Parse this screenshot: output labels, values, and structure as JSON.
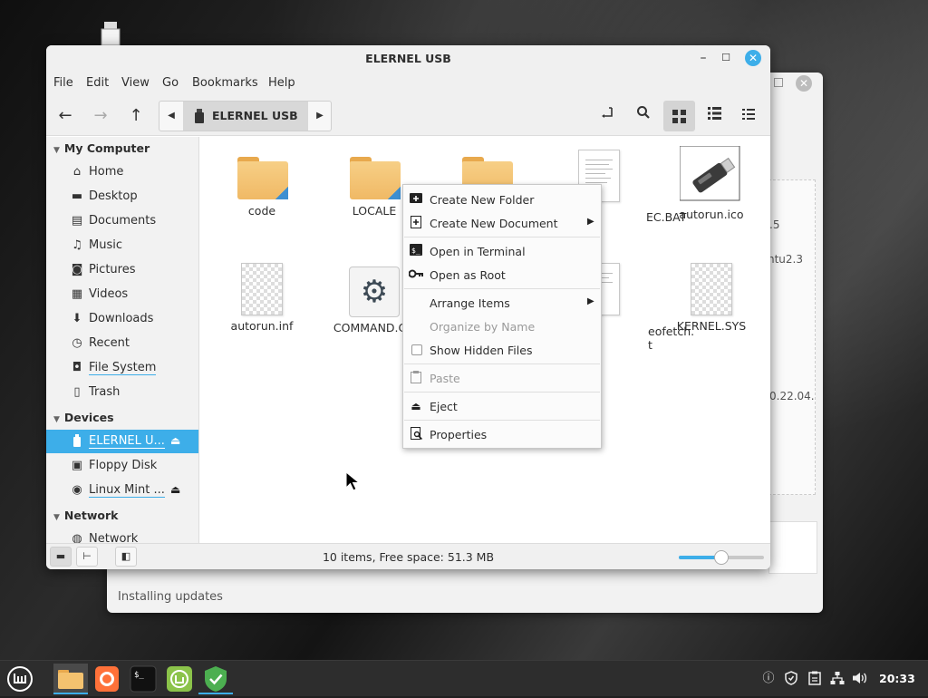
{
  "window": {
    "title": "ELERNEL USB"
  },
  "menubar": [
    "File",
    "Edit",
    "View",
    "Go",
    "Bookmarks",
    "Help"
  ],
  "pathbar": {
    "current": "ELERNEL USB"
  },
  "sidebar": {
    "sections": [
      {
        "title": "My Computer",
        "items": [
          {
            "label": "Home",
            "icon": "home-icon"
          },
          {
            "label": "Desktop",
            "icon": "desktop-icon"
          },
          {
            "label": "Documents",
            "icon": "documents-icon"
          },
          {
            "label": "Music",
            "icon": "music-icon"
          },
          {
            "label": "Pictures",
            "icon": "pictures-icon"
          },
          {
            "label": "Videos",
            "icon": "videos-icon"
          },
          {
            "label": "Downloads",
            "icon": "downloads-icon"
          },
          {
            "label": "Recent",
            "icon": "recent-icon"
          },
          {
            "label": "File System",
            "icon": "filesystem-icon"
          },
          {
            "label": "Trash",
            "icon": "trash-icon"
          }
        ]
      },
      {
        "title": "Devices",
        "items": [
          {
            "label": "ELERNEL U...",
            "icon": "usb-drive-icon",
            "active": true,
            "eject": true
          },
          {
            "label": "Floppy Disk",
            "icon": "floppy-icon"
          },
          {
            "label": "Linux Mint ...",
            "icon": "disc-icon",
            "eject": true
          }
        ]
      },
      {
        "title": "Network",
        "items": [
          {
            "label": "Network",
            "icon": "network-icon"
          }
        ]
      }
    ]
  },
  "files": [
    {
      "name": "code",
      "type": "folder"
    },
    {
      "name": "LOCALE",
      "type": "folder"
    },
    {
      "name": "",
      "type": "folder"
    },
    {
      "name": "EC.BAT",
      "type": "text"
    },
    {
      "name": "autorun.ico",
      "type": "usb-image"
    },
    {
      "name": "autorun.inf",
      "type": "blank"
    },
    {
      "name": "COMMAND.CO",
      "type": "executable"
    },
    {
      "name": "",
      "type": "hidden"
    },
    {
      "name": "eofetch.",
      "name2": "t",
      "type": "text"
    },
    {
      "name": "KERNEL.SYS",
      "type": "blank"
    }
  ],
  "context_menu": {
    "items": [
      {
        "label": "Create New Folder",
        "icon": "new-folder-icon"
      },
      {
        "label": "Create New Document",
        "icon": "new-document-icon",
        "submenu": true
      },
      {
        "label": "Open in Terminal",
        "icon": "terminal-icon"
      },
      {
        "label": "Open as Root",
        "icon": "key-icon"
      },
      {
        "label": "Arrange Items",
        "submenu": true
      },
      {
        "label": "Organize by Name",
        "disabled": true
      },
      {
        "label": "Show Hidden Files",
        "checkbox": true,
        "checked": false
      },
      {
        "label": "Paste",
        "icon": "paste-icon",
        "disabled": true
      },
      {
        "label": "Eject",
        "icon": "eject-icon"
      },
      {
        "label": "Properties",
        "icon": "properties-icon"
      }
    ]
  },
  "statusbar": {
    "text": "10 items, Free space: 51.3 MB",
    "zoom_level": 0.5
  },
  "background_window": {
    "status": "Installing updates",
    "fragments": [
      ".5",
      "ntu2.3",
      "0.22.04."
    ]
  },
  "taskbar": {
    "clock": "20:33",
    "apps": [
      "mint-menu-icon",
      "files-icon",
      "firefox-icon",
      "terminal-icon",
      "mintinstall-icon",
      "mintupdate-icon"
    ],
    "tray": [
      "notification-icon",
      "shield-icon",
      "clipboard-icon",
      "network-icon",
      "volume-icon"
    ]
  },
  "colors": {
    "accent": "#3daee9",
    "folder": "#f0b965",
    "panel": "#2d2d2d"
  }
}
